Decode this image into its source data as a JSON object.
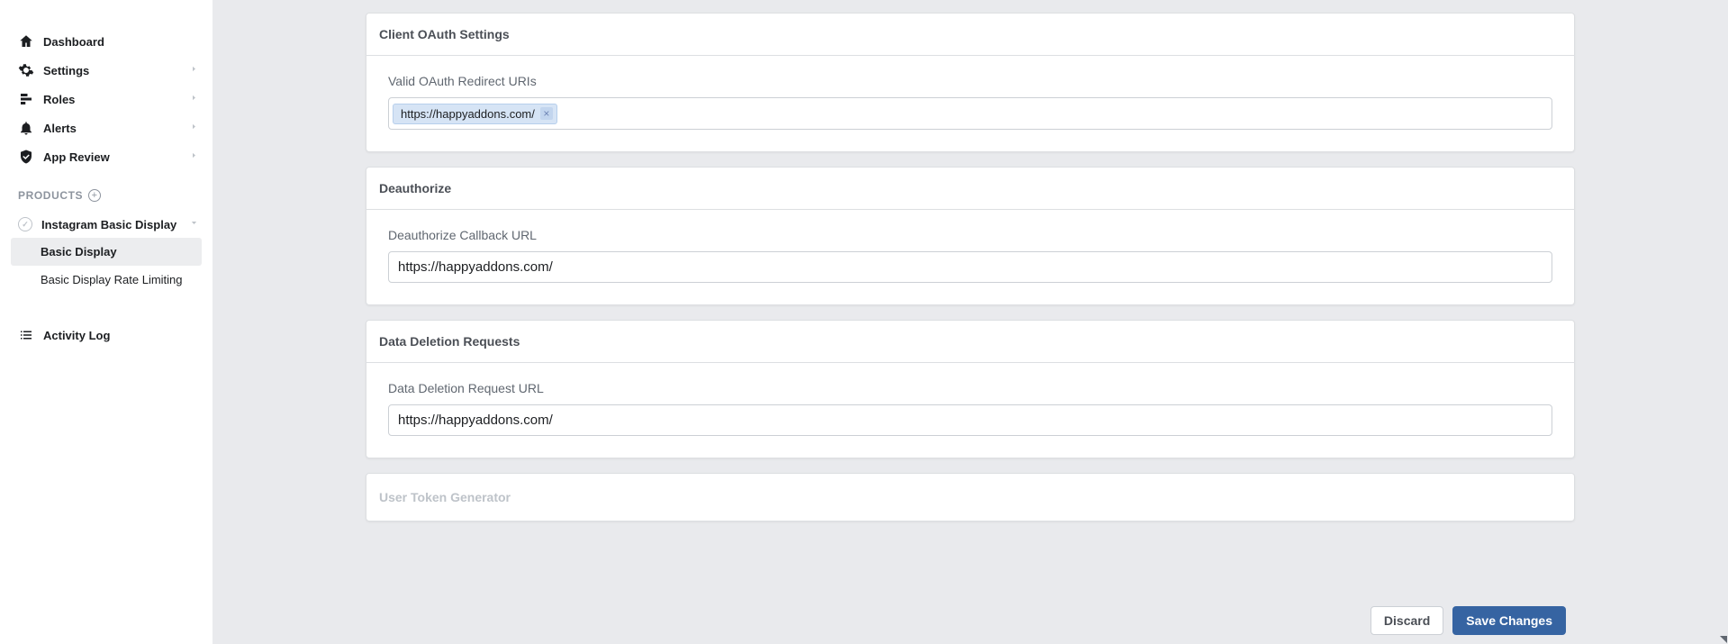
{
  "sidebar": {
    "nav": [
      {
        "label": "Dashboard",
        "icon": "home",
        "expandable": false
      },
      {
        "label": "Settings",
        "icon": "gear",
        "expandable": true
      },
      {
        "label": "Roles",
        "icon": "roles",
        "expandable": true
      },
      {
        "label": "Alerts",
        "icon": "bell",
        "expandable": true
      },
      {
        "label": "App Review",
        "icon": "shield",
        "expandable": true
      }
    ],
    "products_header": "PRODUCTS",
    "products": [
      {
        "label": "Instagram Basic Display",
        "sub": [
          {
            "label": "Basic Display",
            "active": true
          },
          {
            "label": "Basic Display Rate Limiting",
            "active": false
          }
        ]
      }
    ],
    "activity_log": "Activity Log"
  },
  "main": {
    "cards": {
      "oauth": {
        "title": "Client OAuth Settings",
        "redirect_label": "Valid OAuth Redirect URIs",
        "redirect_chip": "https://happyaddons.com/"
      },
      "deauth": {
        "title": "Deauthorize",
        "callback_label": "Deauthorize Callback URL",
        "callback_value": "https://happyaddons.com/"
      },
      "deletion": {
        "title": "Data Deletion Requests",
        "url_label": "Data Deletion Request URL",
        "url_value": "https://happyaddons.com/"
      },
      "token": {
        "title": "User Token Generator"
      }
    }
  },
  "footer": {
    "discard": "Discard",
    "save": "Save Changes"
  }
}
